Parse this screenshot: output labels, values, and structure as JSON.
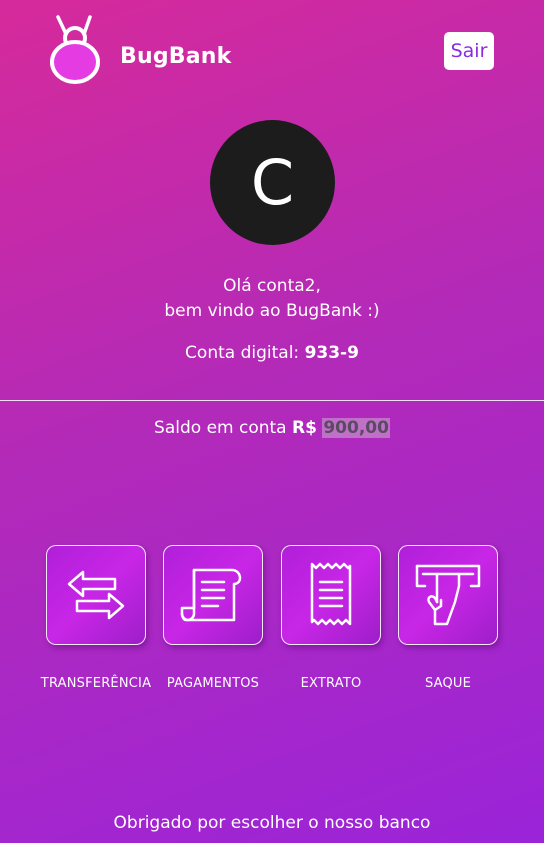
{
  "header": {
    "brand": "BugBank",
    "logout_label": "Sair",
    "logo_icon": "bug-logo-icon"
  },
  "profile": {
    "avatar_initial": "C",
    "greeting_line1": "Olá conta2,",
    "greeting_line2": "bem vindo ao BugBank :)",
    "account_label": "Conta digital:",
    "account_number": "933-9"
  },
  "balance": {
    "label": "Saldo em conta",
    "currency": "R$",
    "amount": "900,00"
  },
  "actions": [
    {
      "label": "TRANSFERÊNCIA",
      "icon": "transfer-arrows-icon"
    },
    {
      "label": "PAGAMENTOS",
      "icon": "payment-scroll-icon"
    },
    {
      "label": "EXTRATO",
      "icon": "receipt-icon"
    },
    {
      "label": "SAQUE",
      "icon": "atm-withdraw-icon"
    }
  ],
  "footer": {
    "text": "Obrigado por escolher o nosso banco"
  },
  "colors": {
    "gradient_start": "#d62a9b",
    "gradient_end": "#9b24d9",
    "logo_fill": "#e53be3",
    "avatar_bg": "#1c1c1c",
    "button_text": "#8a2be2"
  }
}
